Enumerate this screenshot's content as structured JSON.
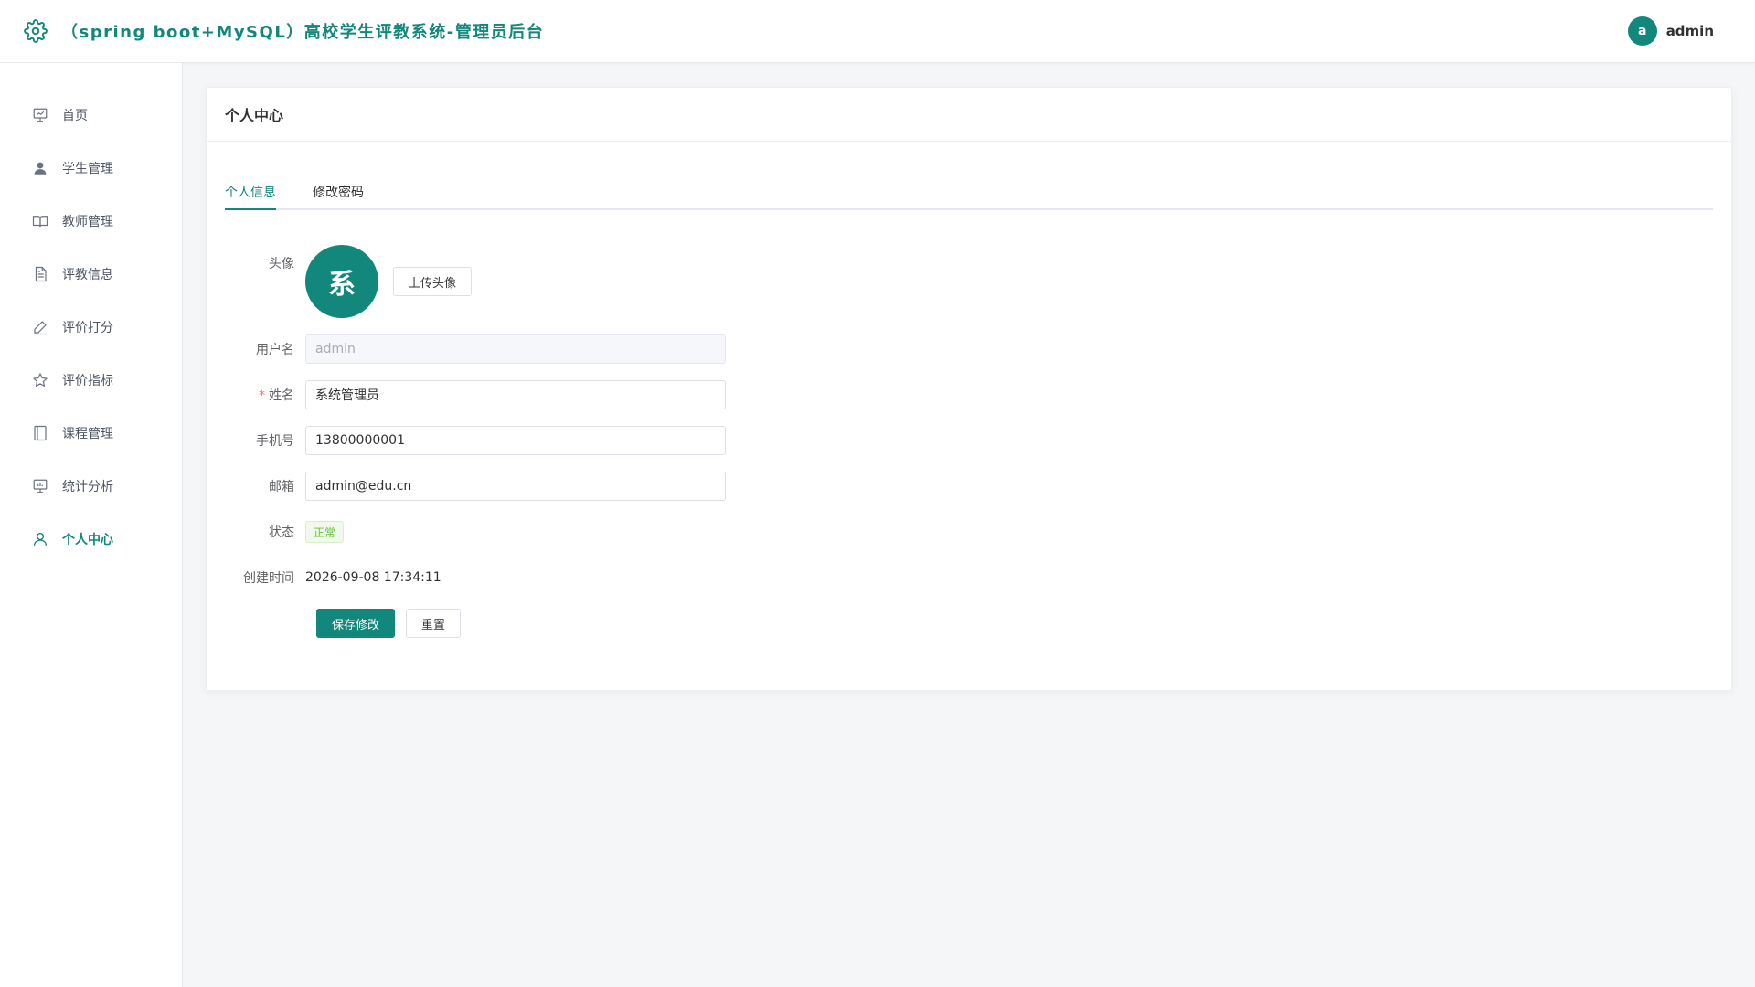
{
  "header": {
    "title": "（spring boot+MySQL）高校学生评教系统-管理员后台",
    "avatar_letter": "a",
    "username": "admin",
    "icon": "gear-icon"
  },
  "sidebar": {
    "items": [
      {
        "label": "首页",
        "icon": "chart-board-icon",
        "active": false
      },
      {
        "label": "学生管理",
        "icon": "user-icon",
        "active": false
      },
      {
        "label": "教师管理",
        "icon": "book-icon",
        "active": false
      },
      {
        "label": "评教信息",
        "icon": "document-icon",
        "active": false
      },
      {
        "label": "评价打分",
        "icon": "pen-icon",
        "active": false
      },
      {
        "label": "评价指标",
        "icon": "star-icon",
        "active": false
      },
      {
        "label": "课程管理",
        "icon": "notebook-icon",
        "active": false
      },
      {
        "label": "统计分析",
        "icon": "presentation-icon",
        "active": false
      },
      {
        "label": "个人中心",
        "icon": "user-outline-icon",
        "active": true
      }
    ]
  },
  "card": {
    "title": "个人中心",
    "tabs": [
      {
        "label": "个人信息",
        "active": true
      },
      {
        "label": "修改密码",
        "active": false
      }
    ]
  },
  "form": {
    "avatar_label": "头像",
    "avatar_char": "系",
    "upload_button": "上传头像",
    "username_label": "用户名",
    "username_value": "admin",
    "name_required": "*",
    "name_label": "姓名",
    "name_value": "系统管理员",
    "phone_label": "手机号",
    "phone_value": "13800000001",
    "email_label": "邮箱",
    "email_value": "admin@edu.cn",
    "status_label": "状态",
    "status_value": "正常",
    "created_label": "创建时间",
    "created_value": "2026-09-08 17:34:11",
    "save_button": "保存修改",
    "reset_button": "重置"
  },
  "colors": {
    "accent": "#12877b",
    "status_success": "#67c23a",
    "required": "#f56c6c"
  }
}
